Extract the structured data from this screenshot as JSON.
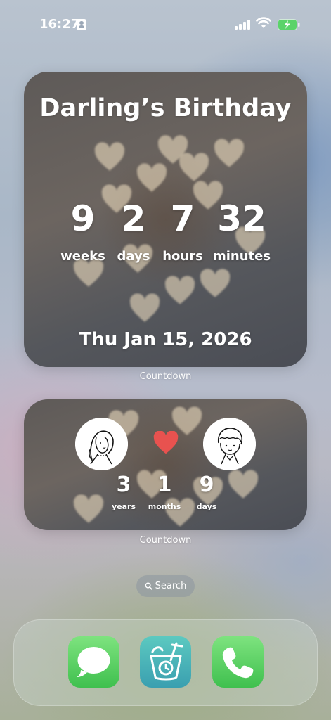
{
  "status_bar": {
    "time": "16:27"
  },
  "countdown_widget": {
    "title": "Darling’s Birthday",
    "counts": [
      {
        "value": "9",
        "unit": "weeks"
      },
      {
        "value": "2",
        "unit": "days"
      },
      {
        "value": "7",
        "unit": "hours"
      },
      {
        "value": "32",
        "unit": "minutes"
      }
    ],
    "date": "Thu Jan 15, 2026",
    "label": "Countdown"
  },
  "relationship_widget": {
    "counts": [
      {
        "value": "3",
        "unit": "years"
      },
      {
        "value": "1",
        "unit": "months"
      },
      {
        "value": "9",
        "unit": "days"
      }
    ],
    "label": "Countdown"
  },
  "search": {
    "label": "Search"
  },
  "dock": {
    "apps": [
      {
        "icon": "messages-icon"
      },
      {
        "icon": "countdown-app-icon"
      },
      {
        "icon": "phone-icon"
      }
    ]
  },
  "colors": {
    "heart_red": "#e8524f",
    "messages_green": "#5fd46a",
    "phone_green": "#5fd46a",
    "countdown_teal": "#4fb7b4"
  }
}
